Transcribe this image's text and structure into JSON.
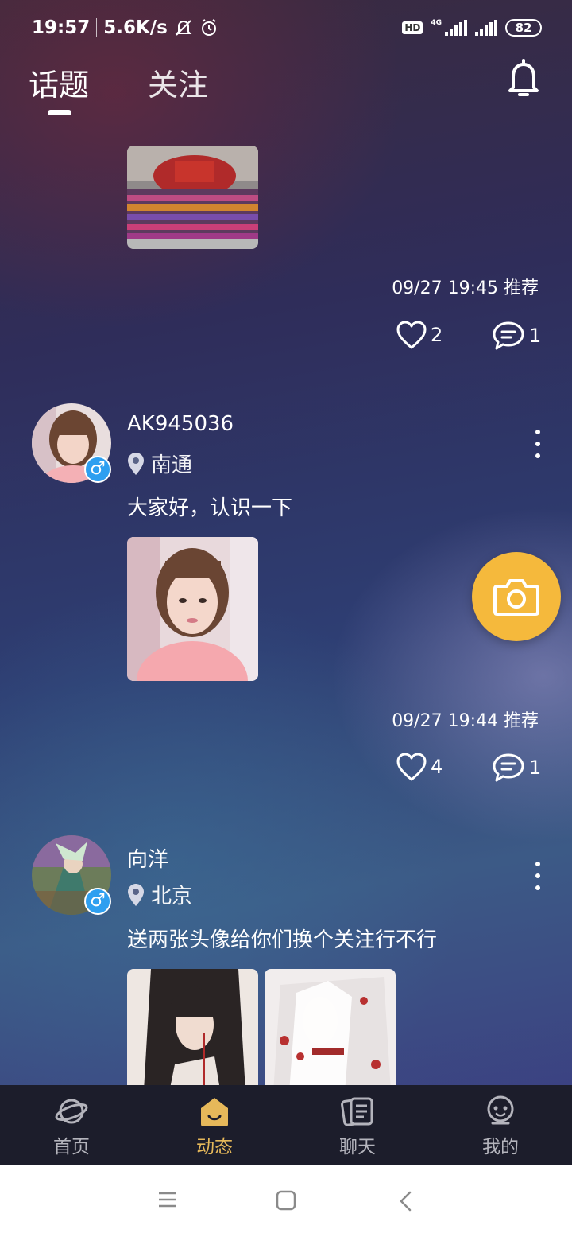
{
  "status_bar": {
    "time": "19:57",
    "speed": "5.6K/s",
    "hd": "HD",
    "network": "4G",
    "battery": "82"
  },
  "tabs": [
    {
      "label": "话题",
      "active": true
    },
    {
      "label": "关注",
      "active": false
    }
  ],
  "posts": [
    {
      "timestamp": "09/27 19:45",
      "tag": "推荐",
      "likes": "2",
      "comments": "1"
    },
    {
      "username": "AK945036",
      "location": "南通",
      "text": "大家好，认识一下",
      "timestamp": "09/27 19:44",
      "tag": "推荐",
      "likes": "4",
      "comments": "1"
    },
    {
      "username": "向洋",
      "location": "北京",
      "text": "送两张头像给你们换个关注行不行"
    }
  ],
  "gender_symbol": "♂",
  "bottom_nav": [
    {
      "label": "首页",
      "icon": "planet-icon",
      "active": false
    },
    {
      "label": "动态",
      "icon": "moments-icon",
      "active": true
    },
    {
      "label": "聊天",
      "icon": "chat-cards-icon",
      "active": false
    },
    {
      "label": "我的",
      "icon": "profile-face-icon",
      "active": false
    }
  ],
  "colors": {
    "accent": "#f5b93c",
    "nav_active": "#e6b85a",
    "gender_male": "#2e9ff0",
    "nav_bg": "#1c1d2b"
  }
}
